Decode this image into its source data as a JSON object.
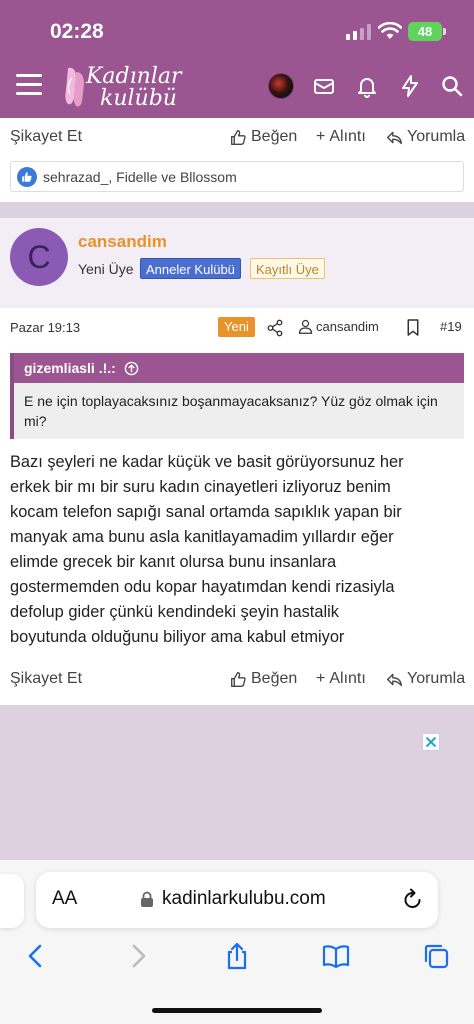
{
  "status": {
    "time": "02:28",
    "battery": "48"
  },
  "header": {
    "logo_line1": "Kadınlar",
    "logo_line2": "kulübü",
    "icons": [
      "menu-icon",
      "avatar",
      "mail-icon",
      "bell-icon",
      "bolt-icon",
      "search-icon"
    ]
  },
  "prev_actions": {
    "report": "Şikayet Et",
    "like": "Beğen",
    "quote": "Alıntı",
    "reply": "Yorumla"
  },
  "reactions": {
    "text": "sehrazad_, Fidelle ve Bllossom"
  },
  "post": {
    "avatar_letter": "C",
    "username": "cansandim",
    "role": "Yeni Üye",
    "badges": [
      "Anneler Kulübü",
      "Kayıtlı Üye"
    ],
    "date": "Pazar 19:13",
    "new_label": "Yeni",
    "author": "cansandim",
    "number": "#19",
    "quote": {
      "author": "gizemliasli .!.:",
      "text": "E ne için toplayacaksınız boşanmayacaksanız? Yüz göz olmak için mi?"
    },
    "body_lines": [
      "Bazı şeyleri ne kadar küçük ve basit görüyorsunuz her",
      "erkek bir mı bir suru kadın cinayetleri izliyoruz benim",
      "kocam telefon sapığı sanal ortamda sapıklık yapan bir",
      "manyak ama bunu asla kanitlayamadim yıllardır eğer",
      "elimde grecek bir kanıt olursa bunu insanlara",
      "gostermemden odu kopar hayatımdan kendi rizasiyla",
      "defolup gider çünkü kendindeki şeyin hastalik",
      "boyutunda olduğunu biliyor ama kabul etmiyor"
    ]
  },
  "post_actions": {
    "report": "Şikayet Et",
    "like": "Beğen",
    "quote": "Alıntı",
    "reply": "Yorumla"
  },
  "browser": {
    "aa_label": "AA",
    "url": "kadinlarkulubu.com",
    "nav": [
      "back-icon",
      "forward-icon",
      "share-icon",
      "bookmarks-icon",
      "tabs-icon"
    ]
  },
  "colors": {
    "brand": "#9b5590",
    "accent": "#e8922a",
    "link_blue": "#4a6fd1"
  }
}
